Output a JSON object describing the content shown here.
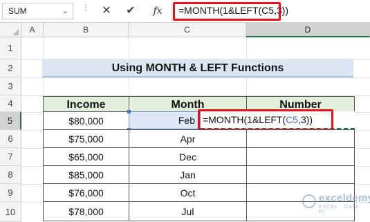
{
  "name_box": {
    "value": "SUM"
  },
  "formula_bar": {
    "cancel_icon": "✕",
    "enter_icon": "✔",
    "fx_label": "fx",
    "formula": "=MONTH(1&LEFT(C5,3))"
  },
  "columns": [
    "A",
    "B",
    "C",
    "D"
  ],
  "rows": [
    "1",
    "2",
    "3",
    "4",
    "5",
    "6",
    "7",
    "8",
    "9",
    "10"
  ],
  "title": "Using MONTH & LEFT Functions",
  "table": {
    "headers": [
      "Income",
      "Month",
      "Number"
    ],
    "rows": [
      {
        "income": "$80,000",
        "month": "Feb"
      },
      {
        "income": "$75,000",
        "month": "Apr"
      },
      {
        "income": "$65,000",
        "month": "Dec"
      },
      {
        "income": "$85,000",
        "month": "Jan"
      },
      {
        "income": "$76,000",
        "month": "Oct"
      },
      {
        "income": "$78,000",
        "month": "Jul"
      }
    ]
  },
  "editing_cell": {
    "prefix": "=MONTH(1&LEFT(",
    "ref": "C5",
    "suffix": ",3))"
  },
  "watermark": {
    "name": "exceldemy",
    "tagline": "EXCEL · DATA · BI"
  },
  "colors": {
    "header_fill": "#e2efda",
    "title_fill": "#dbe6f2",
    "highlight_border": "#e8101c",
    "excel_green": "#217346",
    "ref_blue": "#3f6fc1"
  }
}
